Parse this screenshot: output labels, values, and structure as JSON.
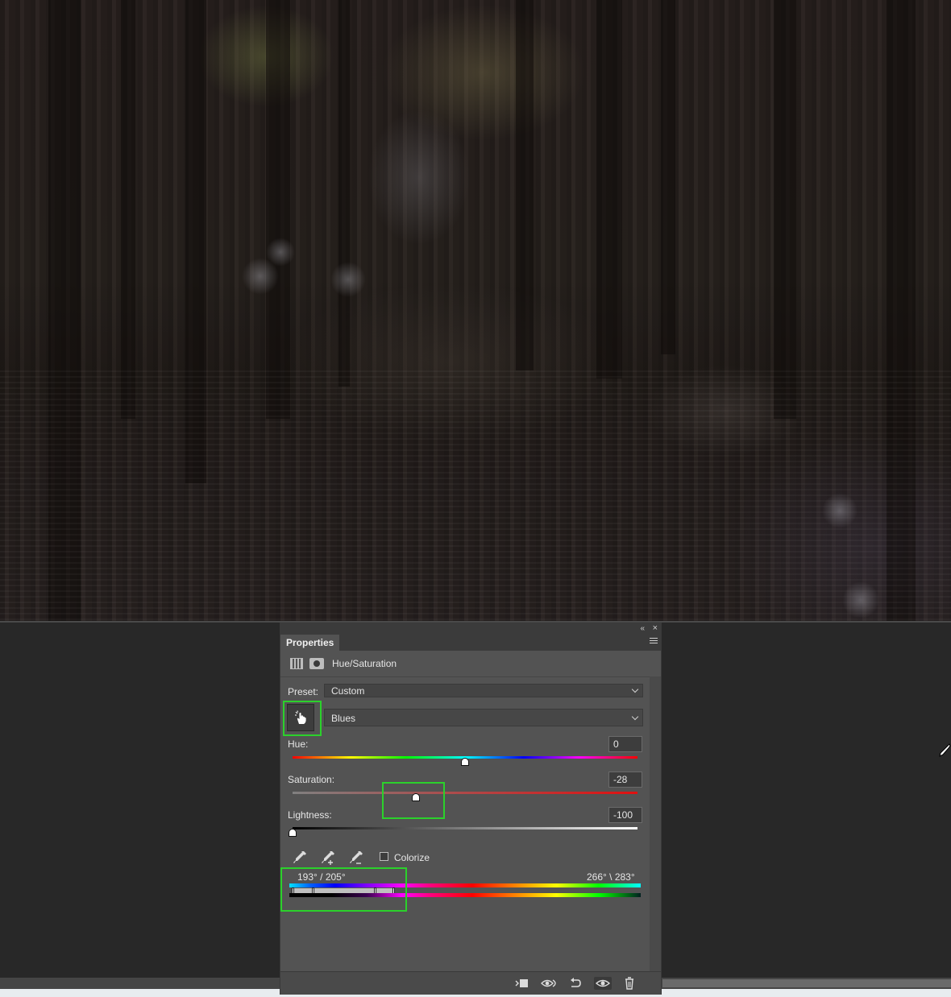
{
  "canvas": {
    "description_icon": "photo-canvas"
  },
  "panel": {
    "tab_label": "Properties",
    "collapse_glyph": "«",
    "close_glyph": "×",
    "adjustment_title": "Hue/Saturation",
    "preset_label": "Preset:",
    "preset_value": "Custom",
    "channel_value": "Blues",
    "hue_label": "Hue:",
    "hue_value": "0",
    "saturation_label": "Saturation:",
    "saturation_value": "-28",
    "lightness_label": "Lightness:",
    "lightness_value": "-100",
    "colorize_label": "Colorize",
    "colorize_checked": false,
    "range_left": "193° / 205°",
    "range_right": "266° \\ 283°",
    "slider_levels": {
      "hue": 0,
      "saturation": -28,
      "lightness": -100
    }
  },
  "colors": {
    "highlight": "#2bd12b",
    "panel_bg": "#535353",
    "app_bg": "#282828"
  },
  "icons": {
    "footer": [
      "clip-to-layer-icon",
      "view-previous-state-icon",
      "reset-icon",
      "toggle-visibility-icon",
      "delete-icon"
    ],
    "eyedroppers": [
      "eyedropper-icon",
      "eyedropper-add-icon",
      "eyedropper-subtract-icon"
    ]
  }
}
